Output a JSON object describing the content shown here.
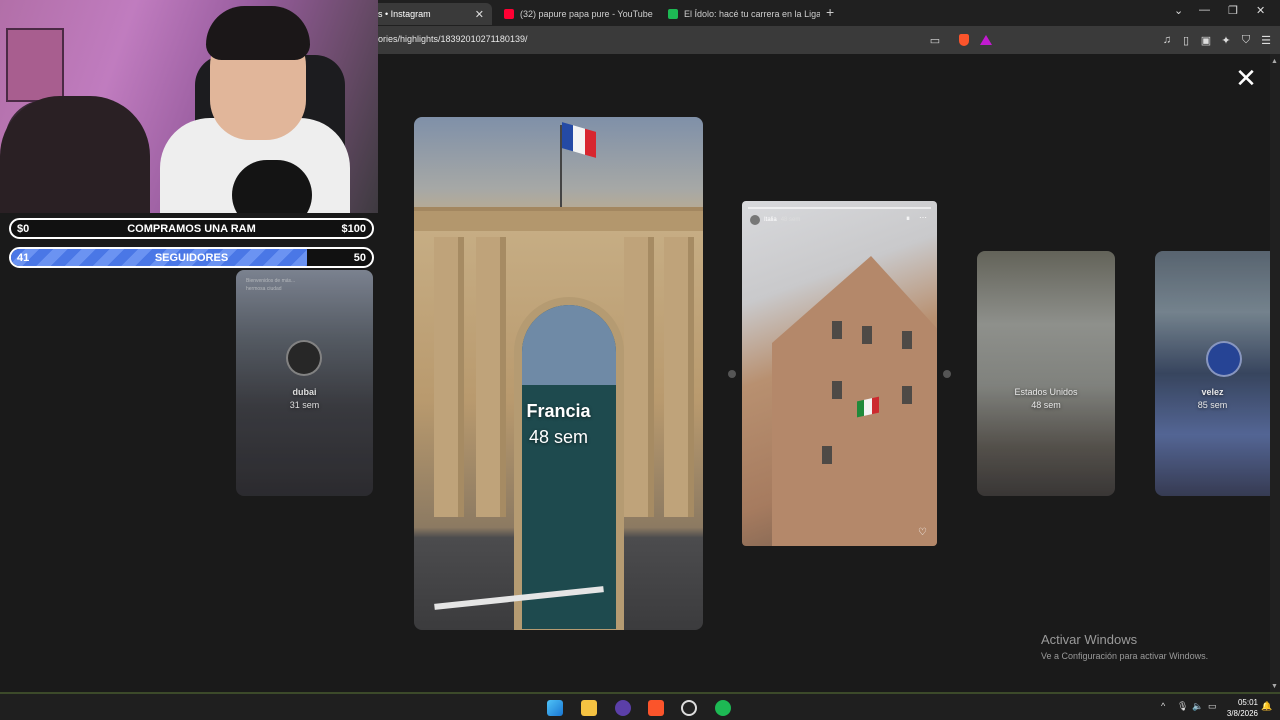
{
  "browser": {
    "tabs": [
      {
        "label": "s • Instagram",
        "active": true
      },
      {
        "label": "(32) papure papa pure - YouTube",
        "active": false
      },
      {
        "label": "El Ídolo: hacé tu carrera en la Liga Ar",
        "active": false
      }
    ],
    "new_tab": "+",
    "url": "ories/highlights/18392010271180139/",
    "window_controls": {
      "dropdown": "⌄",
      "minimize": "—",
      "maximize": "❐",
      "close": "✕"
    }
  },
  "highlights": {
    "close_label": "✕",
    "center": {
      "title": "Francia",
      "age": "48 sem"
    },
    "next": {
      "user": "Italia",
      "time": "48 sem"
    },
    "prev": {
      "title": "dubai",
      "age": "31 sem",
      "overlay_text": "Bienvenidos de más...",
      "overlay_text2": "hermosa ciudad"
    },
    "right1": {
      "title": "Estados Unidos",
      "age": "48 sem"
    },
    "right2": {
      "title": "velez",
      "age": "85 sem"
    }
  },
  "stream_overlay": {
    "goal1": {
      "left": "$0",
      "label": "COMPRAMOS UNA RAM",
      "right": "$100"
    },
    "goal2": {
      "left": "41",
      "label": "SEGUIDORES",
      "right": "50",
      "progress": 0.82
    }
  },
  "windows_watermark": {
    "line1": "Activar Windows",
    "line2": "Ve a Configuración para activar Windows."
  },
  "taskbar": {
    "time": "05:01",
    "date": "3/8/2026",
    "tray_up": "^"
  },
  "colors": {
    "accent_blue": "#4a77e6",
    "instagram_bg": "#1a1a1a",
    "brave_orange": "#fb542b"
  }
}
